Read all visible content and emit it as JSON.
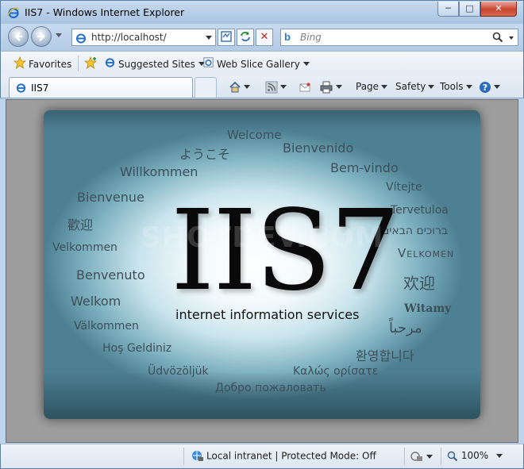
{
  "window": {
    "title": "IIS7 - Windows Internet Explorer",
    "min": "─",
    "max": "□",
    "close": "✕"
  },
  "nav": {
    "url": "http://localhost/",
    "search_placeholder": "Bing"
  },
  "favorites": {
    "favorites_label": "Favorites",
    "suggested_label": "Suggested Sites",
    "webslice_label": "Web Slice Gallery"
  },
  "tab": {
    "title": "IIS7"
  },
  "commands": {
    "page": "Page",
    "safety": "Safety",
    "tools": "Tools"
  },
  "page": {
    "logo": "IIS7",
    "subtitle": "internet information services",
    "watermark": "SHOTDEV.COM",
    "welcome_words": [
      "Welcome",
      "ようこそ",
      "Bienvenido",
      "Willkommen",
      "Bem-vindo",
      "Vítejte",
      "Bienvenue",
      "Tervetuloa",
      "歡迎",
      "ברוכים הבאים",
      "Velkommen",
      "Velkomen",
      "Benvenuto",
      "欢迎",
      "Welkom",
      "Witamy",
      "Välkommen",
      "مرحباً",
      "Hoş Geldiniz",
      "환영합니다",
      "Üdvözöljük",
      "Καλώς ορίσατε",
      "Добро пожаловать"
    ]
  },
  "status": {
    "zone": "Local intranet | Protected Mode: Off",
    "zoom": "100%"
  },
  "colors": {
    "title_gradient_top": "#c9dcef",
    "close_red": "#c9452f",
    "panel_teal": "#4d8092"
  }
}
